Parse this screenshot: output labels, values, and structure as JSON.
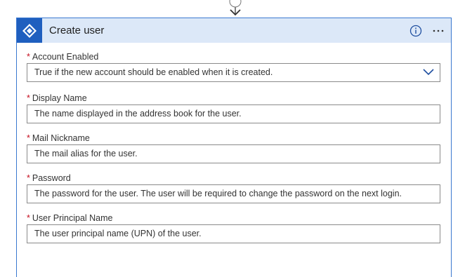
{
  "card": {
    "title": "Create user",
    "header_color": "#dce8f8",
    "accent_color": "#1f5fbf",
    "icons": [
      "azure-ad-icon",
      "info-icon",
      "more-options-icon"
    ]
  },
  "fields": [
    {
      "label": "Account Enabled",
      "required": "*",
      "placeholder": "True if the new account should be enabled when it is created.",
      "type": "dropdown"
    },
    {
      "label": "Display Name",
      "required": "*",
      "placeholder": "The name displayed in the address book for the user.",
      "type": "text"
    },
    {
      "label": "Mail Nickname",
      "required": "*",
      "placeholder": "The mail alias for the user.",
      "type": "text"
    },
    {
      "label": "Password",
      "required": "*",
      "placeholder": "The password for the user. The user will be required to change the password on the next login.",
      "type": "text"
    },
    {
      "label": "User Principal Name",
      "required": "*",
      "placeholder": "The user principal name (UPN) of the user.",
      "type": "text"
    }
  ],
  "more_label": "More options"
}
